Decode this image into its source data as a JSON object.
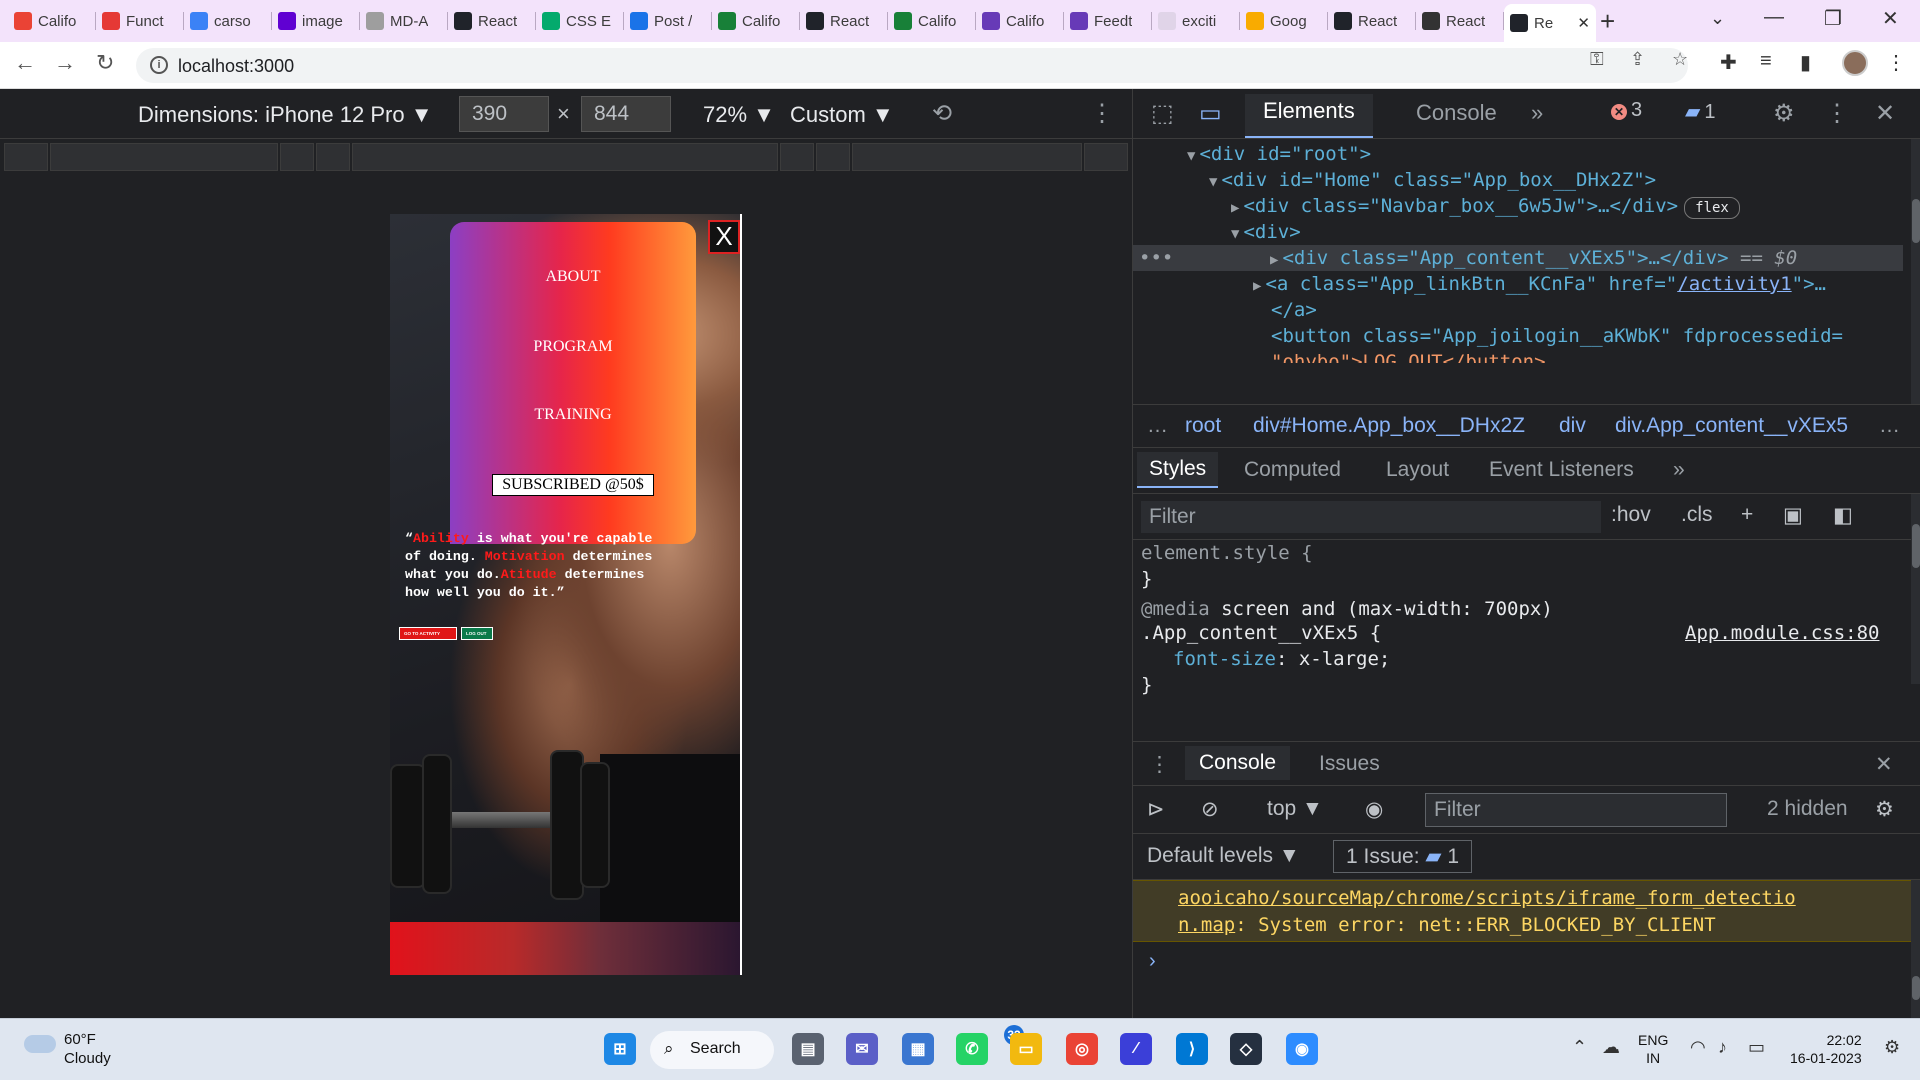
{
  "browser": {
    "tabs": [
      {
        "label": "Califo",
        "icon": "gmail-icon",
        "color": "#ea4335"
      },
      {
        "label": "Funct",
        "icon": "shield-icon",
        "color": "#e53935"
      },
      {
        "label": "carso",
        "icon": "bolt-icon",
        "color": "#3b82f6"
      },
      {
        "label": "image",
        "icon": "yahoo-icon",
        "color": "#6001d2"
      },
      {
        "label": "MD-A",
        "icon": "github-icon",
        "color": "#9e9e9e"
      },
      {
        "label": "React",
        "icon": "react-icon",
        "color": "#20232a"
      },
      {
        "label": "CSS E",
        "icon": "w3schools-icon",
        "color": "#04aa6d"
      },
      {
        "label": "Post /",
        "icon": "z-icon",
        "color": "#1a73e8"
      },
      {
        "label": "Califo",
        "icon": "plus-sheet-icon",
        "color": "#188038"
      },
      {
        "label": "React",
        "icon": "react-icon",
        "color": "#20232a"
      },
      {
        "label": "Califo",
        "icon": "plus-sheet-icon",
        "color": "#188038"
      },
      {
        "label": "Califo",
        "icon": "forms-icon",
        "color": "#673ab7"
      },
      {
        "label": "Feedt",
        "icon": "forms-icon",
        "color": "#673ab7"
      },
      {
        "label": "exciti",
        "icon": "blank-icon",
        "color": "#e0d4e8"
      },
      {
        "label": "Goog",
        "icon": "colab-icon",
        "color": "#f9ab00"
      },
      {
        "label": "React",
        "icon": "react-icon",
        "color": "#20232a"
      },
      {
        "label": "React",
        "icon": "globe-icon",
        "color": "#333333"
      },
      {
        "label": "Re",
        "icon": "react-icon",
        "color": "#20232a",
        "active": true
      }
    ],
    "url": "localhost:3000",
    "new_tab": "+",
    "close_tab": "✕"
  },
  "device_toolbar": {
    "dimensions_label": "Dimensions: iPhone 12 Pro ▼",
    "width": "390",
    "height": "844",
    "times": "×",
    "zoom": "72% ▼",
    "throttle": "Custom ▼"
  },
  "app": {
    "menu": {
      "items": [
        "ABOUT",
        "PROGRAM",
        "TRAINING"
      ],
      "subscribe": "SUBSCRIBED @50$",
      "close": "X"
    },
    "quote": {
      "open": "“",
      "w1": "Ability",
      "t1": " is what you're capable of doing. ",
      "w2": "Motivation",
      "t2": " determines what you do.",
      "w3": "Atitude",
      "t3": " determines how well you do it.”"
    },
    "buttons": {
      "activity": "GO TO ACTIVITY",
      "logout": "LOG OUT"
    }
  },
  "devtools": {
    "tabs": {
      "elements": "Elements",
      "console": "Console",
      "more": "»"
    },
    "errors": "3",
    "messages": "1",
    "dom": {
      "l1": "<div id=\"root\">",
      "l2a": "<div id=\"Home\" class=\"App_box__DHx2Z\">",
      "l3": "<div class=\"Navbar_box__6w5Jw\">…</div>",
      "flex": "flex",
      "l4": "<div>",
      "l5": "<div class=\"App_content__vXEx5\">…</div>",
      "l5b": " == $0",
      "l6a": "<a class=\"App_linkBtn__KCnFa\" href=\"",
      "l6link": "/activity1",
      "l6b": "\">…",
      "l7": "</a>",
      "l8": "<button class=\"App_joilogin__aKWbK\" fdprocessedid=",
      "l9": "\"ohybo\">LOG OUT</button>"
    },
    "breadcrumbs": [
      "…",
      "root",
      "div#Home.App_box__DHx2Z",
      "div",
      "div.App_content__vXEx5",
      "…"
    ],
    "style_tabs": [
      "Styles",
      "Computed",
      "Layout",
      "Event Listeners",
      "»"
    ],
    "style_filter_placeholder": "Filter",
    "hov": ":hov",
    "cls": ".cls",
    "rules": {
      "element_style": "element.style {",
      "close": "}",
      "media_kw": "@media",
      "media_q": " screen and (max-width: 700px)",
      "selector": ".App_content__vXEx5 {",
      "source": "App.module.css:80",
      "prop": "font-size",
      "value": "x-large;"
    },
    "drawer": {
      "tabs": [
        "Console",
        "Issues"
      ],
      "context": "top ▼",
      "filter_placeholder": "Filter",
      "hidden": "2 hidden",
      "levels": "Default levels ▼",
      "issues": "1 Issue:",
      "issue_count": "1",
      "error_link_1": "aooicaho/sourceMap/chrome/scripts/iframe_form_detectio",
      "error_link_2": "n.map",
      "error_text": ": System error: net::ERR_BLOCKED_BY_CLIENT",
      "prompt": "›"
    }
  },
  "taskbar": {
    "weather_temp": "60°F",
    "weather_cond": "Cloudy",
    "search": "Search",
    "whatsapp_badge": "33",
    "lang_1": "ENG",
    "lang_2": "IN",
    "time": "22:02",
    "date": "16-01-2023"
  }
}
